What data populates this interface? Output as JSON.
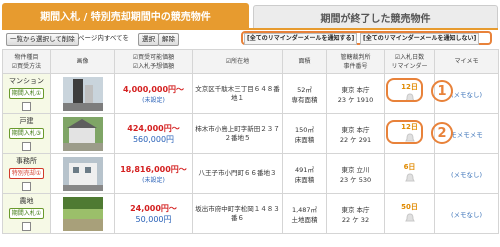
{
  "tabs": {
    "active": "期間入札 / 特別売却期間中の競売物件",
    "inactive": "期間が終了した競売物件"
  },
  "toolbar": {
    "select_all_button": "一覧から選択して削除",
    "page_text": "ページ内すべてを",
    "select_button": "選択",
    "clear_button": "解除",
    "notify_all": "[全てのリマインダーメールを通知する]",
    "no_notify_all": "[全てのリマインダーメールを通知しない]"
  },
  "table": {
    "headers": {
      "type": "物件種目",
      "method": "☑買受方法",
      "image": "画像",
      "price1": "☑買受可能価額",
      "price2": "☑入札予想価額",
      "location": "☑所在地",
      "area": "面積",
      "court1": "管轄裁判所",
      "court2": "事件番号",
      "days1": "☑入札日数",
      "days2": "リマインダー",
      "my": "マイメモ"
    },
    "rows": [
      {
        "type": "マンション",
        "method": "期間入札①",
        "price_main": "4,000,000円〜",
        "price_sub": "(未設定)",
        "location": "文京区千駄木三丁目６４８番地１",
        "area": "52㎡",
        "area_sub": "専有面積",
        "court": "東京 本庁",
        "case": "23 ケ 1910",
        "days": "12日",
        "my": "(メモなし)"
      },
      {
        "type": "戸建",
        "method": "期間入札③",
        "price_main": "424,000円〜",
        "price_sub": "560,000円",
        "location": "柿木市小島上町字新田２３７２番地５",
        "area": "150㎡",
        "area_sub": "床面積",
        "court": "東京 本庁",
        "case": "22 ケ 291",
        "days": "12日",
        "my": "モメモメモ"
      },
      {
        "type": "事務所",
        "method": "特別売却①",
        "price_main": "18,816,000円〜",
        "price_sub": "(未設定)",
        "location": "八王子市小門町６６番地３",
        "area": "491㎡",
        "area_sub": "床面積",
        "court": "東京 立川",
        "case": "23 ケ 530",
        "days": "6日",
        "my": "(メモなし)"
      },
      {
        "type": "農地",
        "method": "期間入札①",
        "price_main": "24,000円〜",
        "price_sub": "50,000円",
        "location": "坂出市府中町字松岡１４８３番６",
        "area": "1,487㎡",
        "area_sub": "土地面積",
        "court": "東京 本庁",
        "case": "22 ケ 32",
        "days": "50日",
        "my": "(メモなし)"
      }
    ]
  },
  "annotations": {
    "one": "1",
    "two": "2"
  },
  "colors": {
    "accent": "#e79b2f",
    "highlight": "#e8823a",
    "price": "#d42020",
    "link": "#2a62b8"
  }
}
